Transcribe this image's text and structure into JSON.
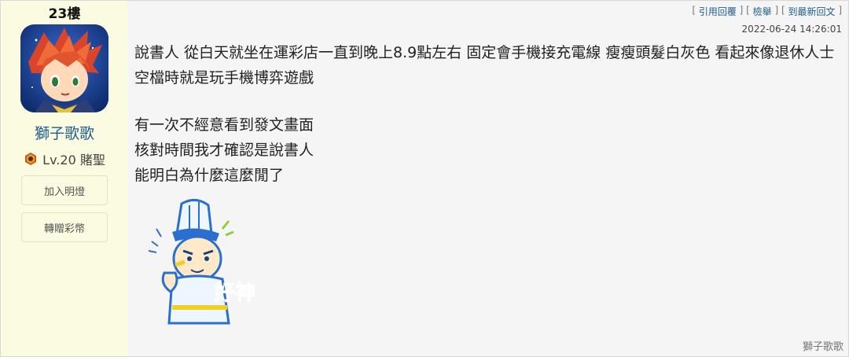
{
  "post": {
    "floor": "23樓",
    "author": {
      "name": "獅子歌歌",
      "level": "Lv.20 賭聖"
    },
    "sidebar_buttons": [
      "加入明燈",
      "轉贈彩幣"
    ],
    "actions": {
      "quote_reply": "引用回覆",
      "report": "檢舉",
      "goto_latest": "到最新回文"
    },
    "timestamp": "2022-06-24 14:26:01",
    "paragraph1": "說書人 從白天就坐在運彩店一直到晚上8.9點左右 固定會手機接充電線 瘦瘦頭髮白灰色 看起來像退休人士 空檔時就是玩手機博弈遊戲",
    "lines": [
      "有一次不經意看到發文畫面",
      "核對時間我才確認是說書人",
      "能明白為什麼這麼閒了"
    ],
    "sticker_text": "好神",
    "signature": "獅子歌歌"
  },
  "colors": {
    "sidebar_bg": "#fbfbe1",
    "link": "#1e5d8d",
    "page_bg": "#f5f5f5"
  }
}
